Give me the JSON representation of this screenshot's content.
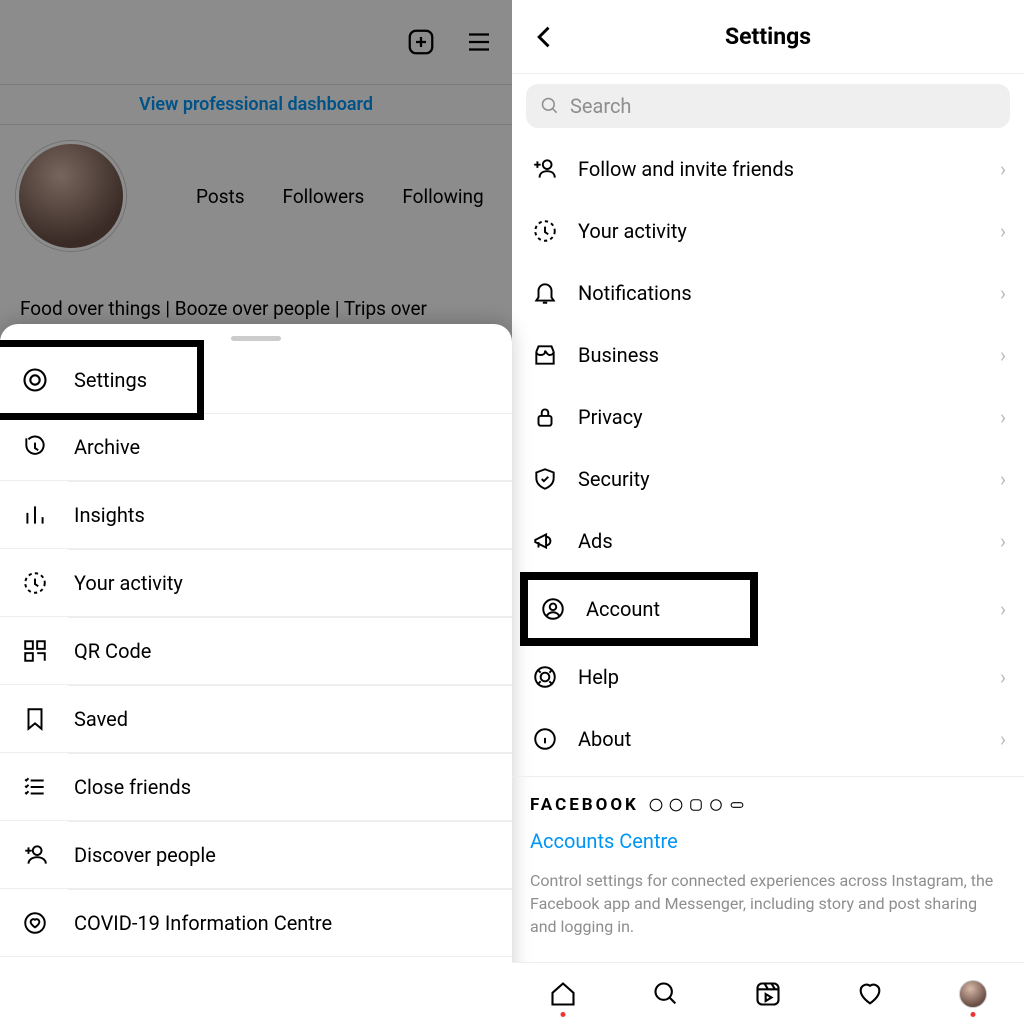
{
  "left": {
    "dashboard_link": "View professional dashboard",
    "stats": {
      "posts": "Posts",
      "followers": "Followers",
      "following": "Following"
    },
    "bio": "Food over things | Booze over people | Trips over",
    "sheet": {
      "items": [
        {
          "key": "settings",
          "label": "Settings",
          "highlighted": true
        },
        {
          "key": "archive",
          "label": "Archive"
        },
        {
          "key": "insights",
          "label": "Insights"
        },
        {
          "key": "activity",
          "label": "Your activity"
        },
        {
          "key": "qr",
          "label": "QR Code"
        },
        {
          "key": "saved",
          "label": "Saved"
        },
        {
          "key": "close",
          "label": "Close friends"
        },
        {
          "key": "discover",
          "label": "Discover people"
        },
        {
          "key": "covid",
          "label": "COVID-19 Information Centre"
        }
      ]
    }
  },
  "right": {
    "title": "Settings",
    "search_placeholder": "Search",
    "items": [
      {
        "key": "follow",
        "label": "Follow and invite friends"
      },
      {
        "key": "activity",
        "label": "Your activity"
      },
      {
        "key": "notifications",
        "label": "Notifications"
      },
      {
        "key": "business",
        "label": "Business"
      },
      {
        "key": "privacy",
        "label": "Privacy"
      },
      {
        "key": "security",
        "label": "Security"
      },
      {
        "key": "ads",
        "label": "Ads"
      },
      {
        "key": "account",
        "label": "Account",
        "highlighted": true
      },
      {
        "key": "help",
        "label": "Help"
      },
      {
        "key": "about",
        "label": "About"
      }
    ],
    "fb": {
      "brand": "FACEBOOK",
      "accounts_centre": "Accounts Centre",
      "description": "Control settings for connected experiences across Instagram, the Facebook app and Messenger, including story and post sharing and logging in."
    }
  }
}
